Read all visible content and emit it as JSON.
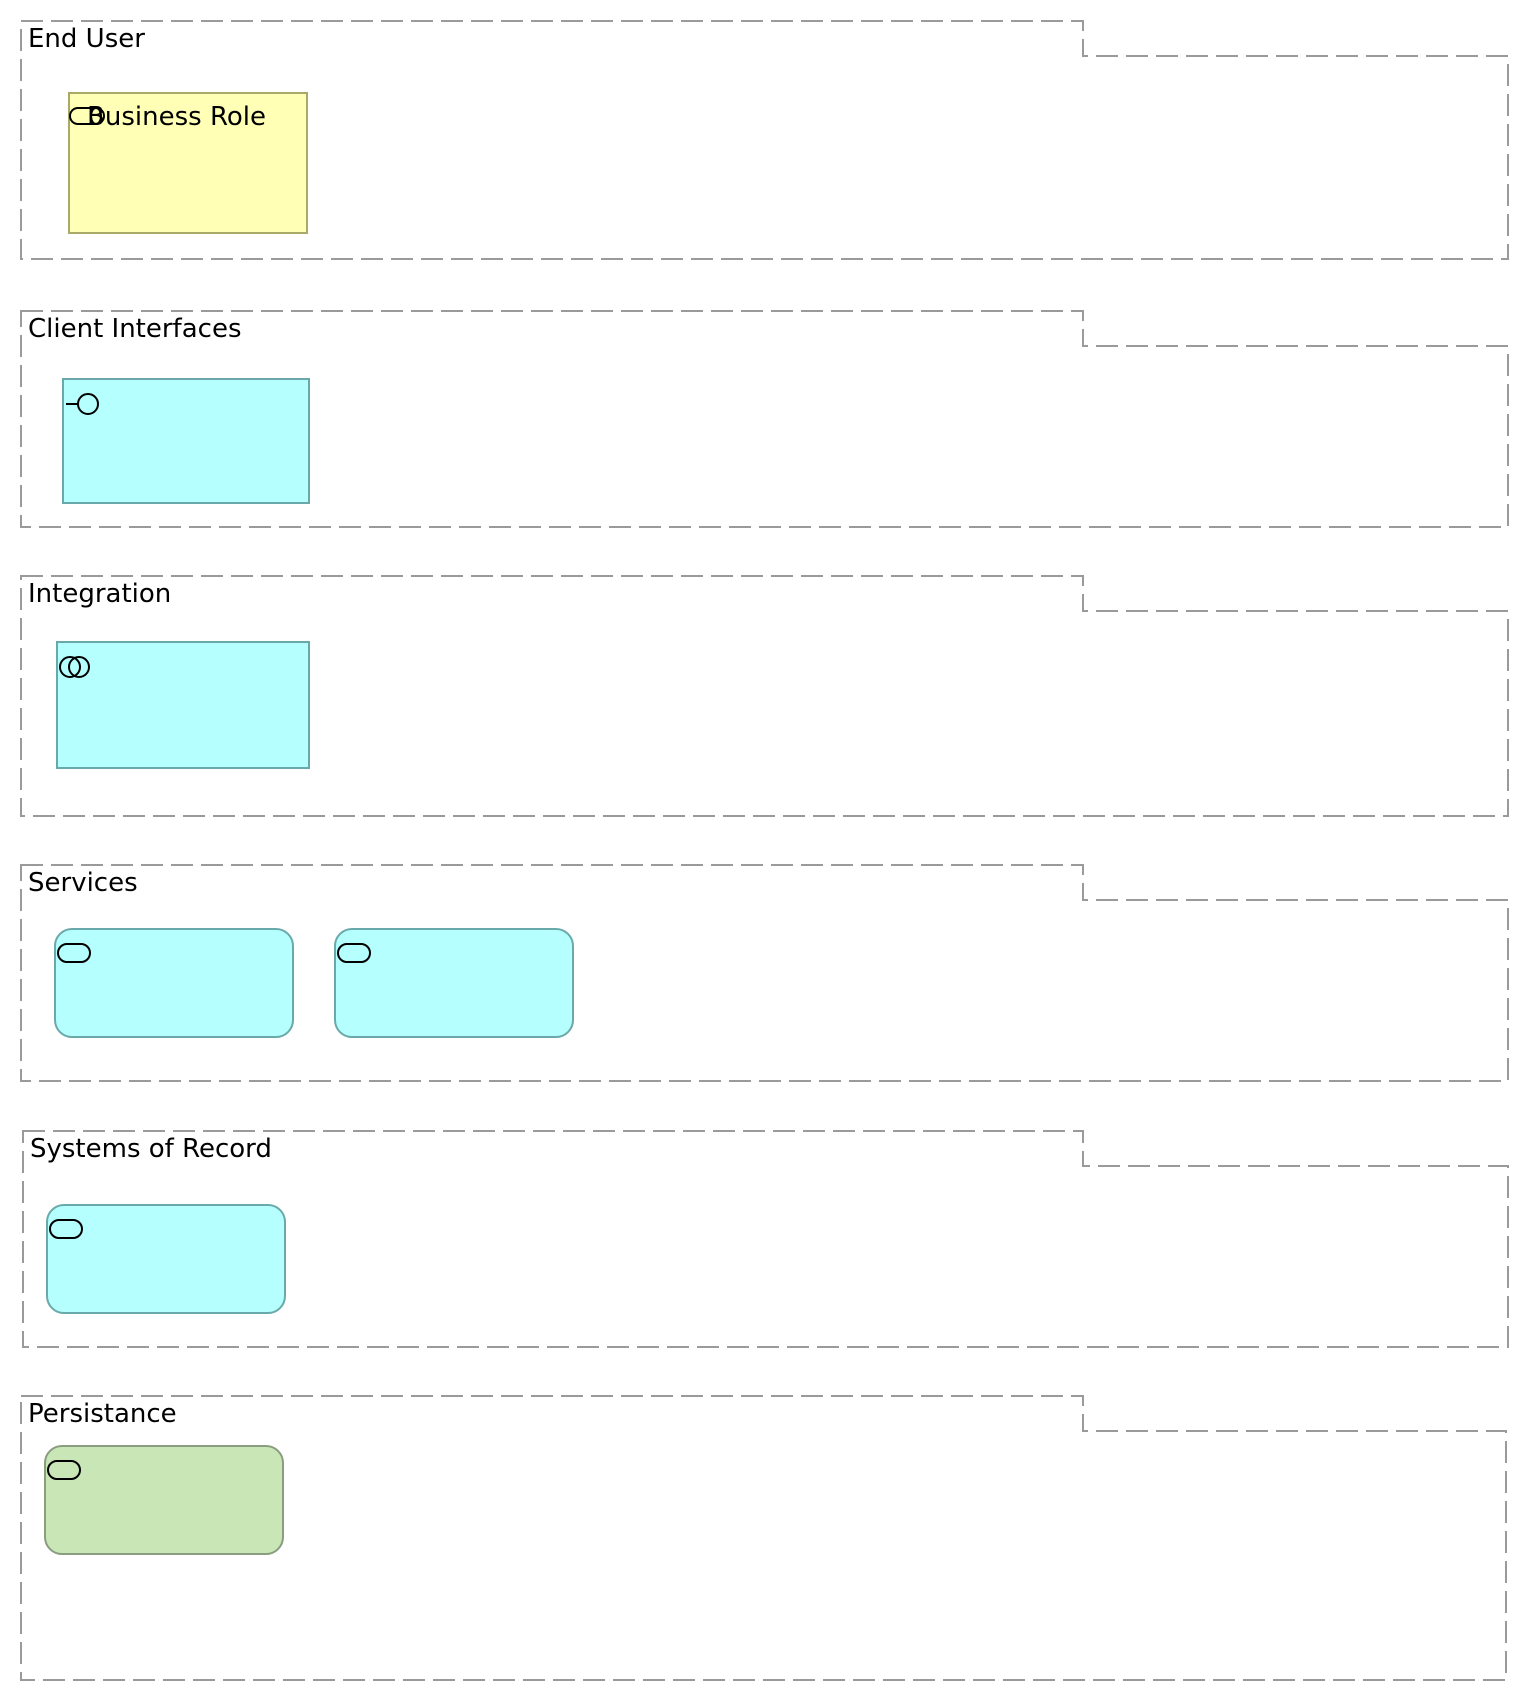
{
  "groups": [
    {
      "label": "End User"
    },
    {
      "label": "Client Interfaces"
    },
    {
      "label": "Integration"
    },
    {
      "label": "Services"
    },
    {
      "label": "Systems of Record"
    },
    {
      "label": "Persistance"
    }
  ],
  "elements": {
    "business_role": {
      "label": "Business Role",
      "icon": "business-role-icon"
    },
    "client_interface": {
      "label": "",
      "icon": "application-interface-icon"
    },
    "integration": {
      "label": "",
      "icon": "application-collaboration-icon"
    },
    "service_1": {
      "label": "",
      "icon": "application-service-icon"
    },
    "service_2": {
      "label": "",
      "icon": "application-service-icon"
    },
    "system_of_record": {
      "label": "",
      "icon": "application-service-icon"
    },
    "persistence": {
      "label": "",
      "icon": "technology-service-icon"
    }
  },
  "colors": {
    "business_fill": "#ffffb5",
    "application_fill": "#b5ffff",
    "technology_fill": "#c9e6b7",
    "group_border": "#9a9a9a"
  }
}
